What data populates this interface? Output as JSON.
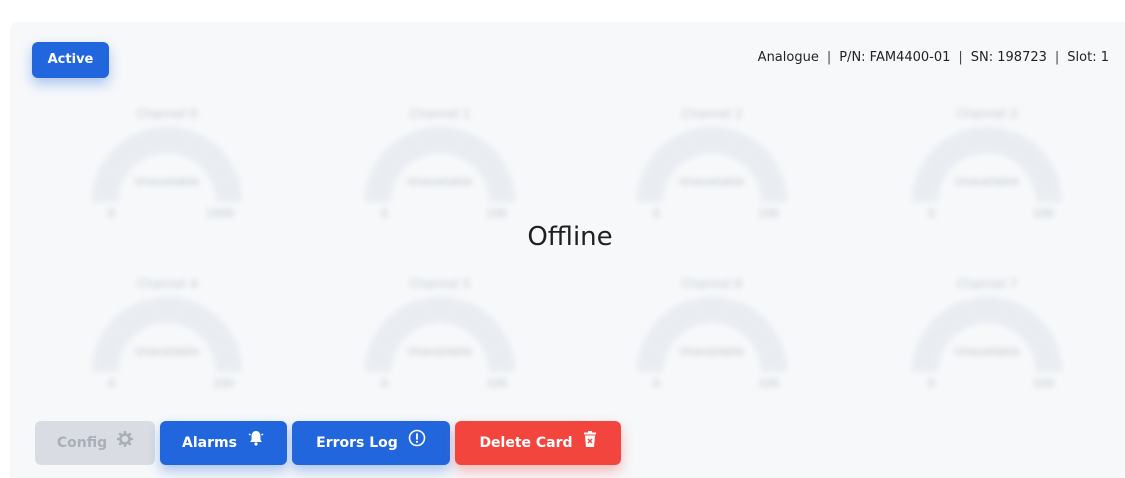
{
  "card": {
    "status": "Active",
    "type": "Analogue",
    "part_number": "P/N: FAM4400-01",
    "serial_number": "SN: 198723",
    "slot": "Slot: 1",
    "state_overlay": "Offline"
  },
  "channels": [
    {
      "title": "Channel 0",
      "value": "Unavailable",
      "min": "0",
      "max": "1000"
    },
    {
      "title": "Channel 1",
      "value": "Unavailable",
      "min": "0",
      "max": "100"
    },
    {
      "title": "Channel 2",
      "value": "Unavailable",
      "min": "0",
      "max": "100"
    },
    {
      "title": "Channel 3",
      "value": "Unavailable",
      "min": "0",
      "max": "100"
    },
    {
      "title": "Channel 4",
      "value": "Unavailable",
      "min": "0",
      "max": "100"
    },
    {
      "title": "Channel 5",
      "value": "Unavailable",
      "min": "0",
      "max": "100"
    },
    {
      "title": "Channel 6",
      "value": "Unavailable",
      "min": "0",
      "max": "100"
    },
    {
      "title": "Channel 7",
      "value": "Unavailable",
      "min": "0",
      "max": "100"
    }
  ],
  "actions": {
    "config": {
      "label": "Config",
      "icon": "gear-icon",
      "enabled": false
    },
    "alarms": {
      "label": "Alarms",
      "icon": "bell-icon"
    },
    "errors_log": {
      "label": "Errors Log",
      "icon": "exclamation-circle-icon"
    },
    "delete_card": {
      "label": "Delete Card",
      "icon": "trash-icon"
    }
  },
  "colors": {
    "primary": "#2166dc",
    "danger": "#f2453d",
    "disabled": "#d9dde3"
  }
}
